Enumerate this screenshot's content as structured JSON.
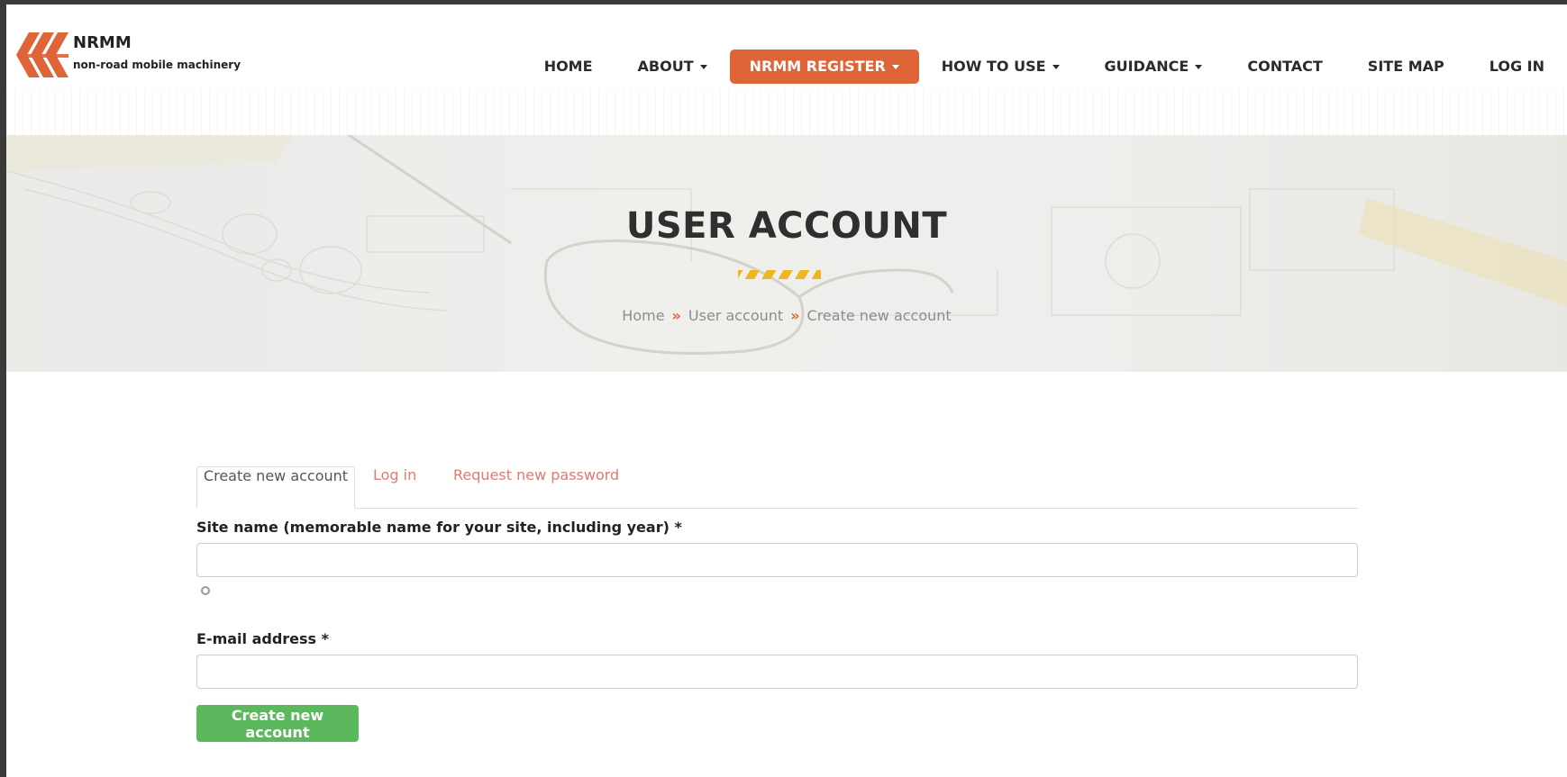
{
  "brand": {
    "title": "NRMM",
    "subtitle": "non-road mobile machinery",
    "logo_color": "#df6437"
  },
  "nav": {
    "home": "HOME",
    "about": "ABOUT",
    "register": "NRMM REGISTER",
    "how_to_use": "HOW TO USE",
    "guidance": "GUIDANCE",
    "contact": "CONTACT",
    "site_map": "SITE MAP",
    "log_in": "LOG IN",
    "active_color": "#df6437"
  },
  "hero": {
    "title": "USER ACCOUNT",
    "breadcrumb": {
      "home": "Home",
      "user_account": "User account",
      "current": "Create new account",
      "separator": "»"
    },
    "stripe_color": "#f0b621"
  },
  "tabs": {
    "create": "Create new account",
    "login": "Log in",
    "request_password": "Request new password"
  },
  "form": {
    "site_name_label": "Site name (memorable name for your site, including year) *",
    "site_name_value": "",
    "email_label": "E-mail address *",
    "email_value": "",
    "submit_label": "Create new account",
    "submit_color": "#5cb85c"
  }
}
